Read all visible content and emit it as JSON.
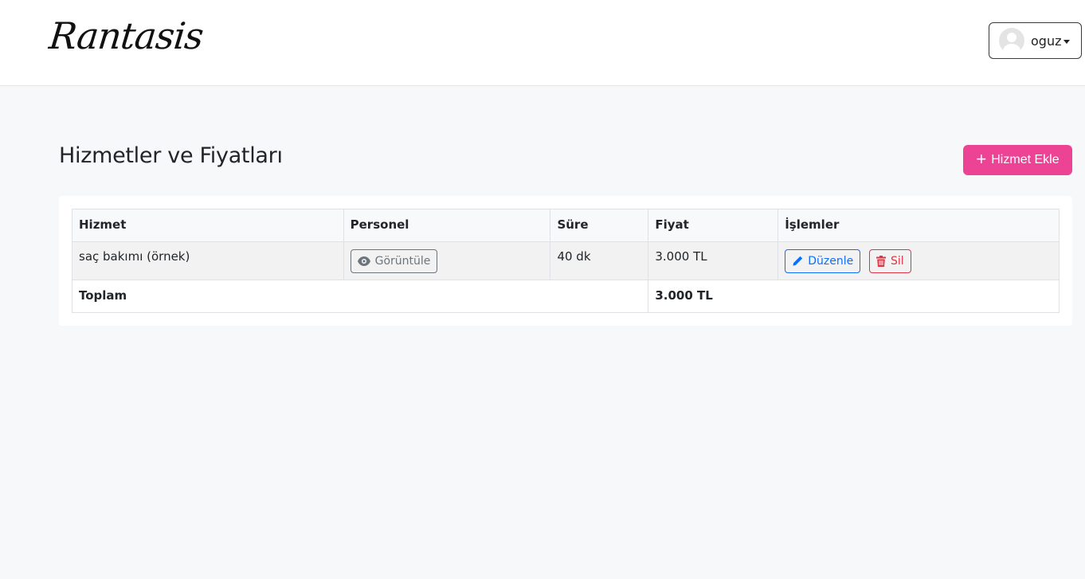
{
  "header": {
    "logo_text": "Rantasis",
    "user_name": "oguz"
  },
  "page": {
    "title": "Hizmetler ve Fiyatları",
    "add_button_label": "Hizmet Ekle"
  },
  "table": {
    "columns": [
      "Hizmet",
      "Personel",
      "Süre",
      "Fiyat",
      "İşlemler"
    ],
    "rows": [
      {
        "service": "saç bakımı (örnek)",
        "staff_button": "Görüntüle",
        "duration": "40 dk",
        "price": "3.000 TL",
        "edit_label": "Düzenle",
        "delete_label": "Sil"
      }
    ],
    "total_label": "Toplam",
    "total_value": "3.000 TL"
  },
  "colors": {
    "accent": "#ec4395",
    "edit": "#0d6efd",
    "delete": "#dc3545",
    "view": "#6c757d"
  }
}
